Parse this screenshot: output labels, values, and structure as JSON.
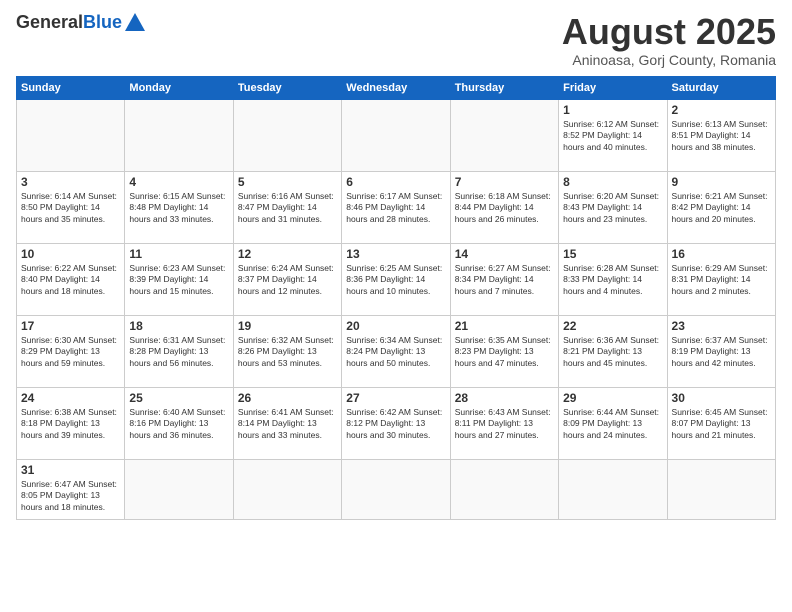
{
  "logo": {
    "general": "General",
    "blue": "Blue"
  },
  "title": {
    "month_year": "August 2025",
    "location": "Aninoasa, Gorj County, Romania"
  },
  "weekdays": [
    "Sunday",
    "Monday",
    "Tuesday",
    "Wednesday",
    "Thursday",
    "Friday",
    "Saturday"
  ],
  "days": [
    {
      "date": "",
      "info": ""
    },
    {
      "date": "",
      "info": ""
    },
    {
      "date": "",
      "info": ""
    },
    {
      "date": "",
      "info": ""
    },
    {
      "date": "",
      "info": ""
    },
    {
      "date": "1",
      "info": "Sunrise: 6:12 AM\nSunset: 8:52 PM\nDaylight: 14 hours\nand 40 minutes."
    },
    {
      "date": "2",
      "info": "Sunrise: 6:13 AM\nSunset: 8:51 PM\nDaylight: 14 hours\nand 38 minutes."
    },
    {
      "date": "3",
      "info": "Sunrise: 6:14 AM\nSunset: 8:50 PM\nDaylight: 14 hours\nand 35 minutes."
    },
    {
      "date": "4",
      "info": "Sunrise: 6:15 AM\nSunset: 8:48 PM\nDaylight: 14 hours\nand 33 minutes."
    },
    {
      "date": "5",
      "info": "Sunrise: 6:16 AM\nSunset: 8:47 PM\nDaylight: 14 hours\nand 31 minutes."
    },
    {
      "date": "6",
      "info": "Sunrise: 6:17 AM\nSunset: 8:46 PM\nDaylight: 14 hours\nand 28 minutes."
    },
    {
      "date": "7",
      "info": "Sunrise: 6:18 AM\nSunset: 8:44 PM\nDaylight: 14 hours\nand 26 minutes."
    },
    {
      "date": "8",
      "info": "Sunrise: 6:20 AM\nSunset: 8:43 PM\nDaylight: 14 hours\nand 23 minutes."
    },
    {
      "date": "9",
      "info": "Sunrise: 6:21 AM\nSunset: 8:42 PM\nDaylight: 14 hours\nand 20 minutes."
    },
    {
      "date": "10",
      "info": "Sunrise: 6:22 AM\nSunset: 8:40 PM\nDaylight: 14 hours\nand 18 minutes."
    },
    {
      "date": "11",
      "info": "Sunrise: 6:23 AM\nSunset: 8:39 PM\nDaylight: 14 hours\nand 15 minutes."
    },
    {
      "date": "12",
      "info": "Sunrise: 6:24 AM\nSunset: 8:37 PM\nDaylight: 14 hours\nand 12 minutes."
    },
    {
      "date": "13",
      "info": "Sunrise: 6:25 AM\nSunset: 8:36 PM\nDaylight: 14 hours\nand 10 minutes."
    },
    {
      "date": "14",
      "info": "Sunrise: 6:27 AM\nSunset: 8:34 PM\nDaylight: 14 hours\nand 7 minutes."
    },
    {
      "date": "15",
      "info": "Sunrise: 6:28 AM\nSunset: 8:33 PM\nDaylight: 14 hours\nand 4 minutes."
    },
    {
      "date": "16",
      "info": "Sunrise: 6:29 AM\nSunset: 8:31 PM\nDaylight: 14 hours\nand 2 minutes."
    },
    {
      "date": "17",
      "info": "Sunrise: 6:30 AM\nSunset: 8:29 PM\nDaylight: 13 hours\nand 59 minutes."
    },
    {
      "date": "18",
      "info": "Sunrise: 6:31 AM\nSunset: 8:28 PM\nDaylight: 13 hours\nand 56 minutes."
    },
    {
      "date": "19",
      "info": "Sunrise: 6:32 AM\nSunset: 8:26 PM\nDaylight: 13 hours\nand 53 minutes."
    },
    {
      "date": "20",
      "info": "Sunrise: 6:34 AM\nSunset: 8:24 PM\nDaylight: 13 hours\nand 50 minutes."
    },
    {
      "date": "21",
      "info": "Sunrise: 6:35 AM\nSunset: 8:23 PM\nDaylight: 13 hours\nand 47 minutes."
    },
    {
      "date": "22",
      "info": "Sunrise: 6:36 AM\nSunset: 8:21 PM\nDaylight: 13 hours\nand 45 minutes."
    },
    {
      "date": "23",
      "info": "Sunrise: 6:37 AM\nSunset: 8:19 PM\nDaylight: 13 hours\nand 42 minutes."
    },
    {
      "date": "24",
      "info": "Sunrise: 6:38 AM\nSunset: 8:18 PM\nDaylight: 13 hours\nand 39 minutes."
    },
    {
      "date": "25",
      "info": "Sunrise: 6:40 AM\nSunset: 8:16 PM\nDaylight: 13 hours\nand 36 minutes."
    },
    {
      "date": "26",
      "info": "Sunrise: 6:41 AM\nSunset: 8:14 PM\nDaylight: 13 hours\nand 33 minutes."
    },
    {
      "date": "27",
      "info": "Sunrise: 6:42 AM\nSunset: 8:12 PM\nDaylight: 13 hours\nand 30 minutes."
    },
    {
      "date": "28",
      "info": "Sunrise: 6:43 AM\nSunset: 8:11 PM\nDaylight: 13 hours\nand 27 minutes."
    },
    {
      "date": "29",
      "info": "Sunrise: 6:44 AM\nSunset: 8:09 PM\nDaylight: 13 hours\nand 24 minutes."
    },
    {
      "date": "30",
      "info": "Sunrise: 6:45 AM\nSunset: 8:07 PM\nDaylight: 13 hours\nand 21 minutes."
    },
    {
      "date": "31",
      "info": "Sunrise: 6:47 AM\nSunset: 8:05 PM\nDaylight: 13 hours\nand 18 minutes."
    },
    {
      "date": "",
      "info": ""
    },
    {
      "date": "",
      "info": ""
    },
    {
      "date": "",
      "info": ""
    },
    {
      "date": "",
      "info": ""
    },
    {
      "date": "",
      "info": ""
    },
    {
      "date": "",
      "info": ""
    }
  ]
}
